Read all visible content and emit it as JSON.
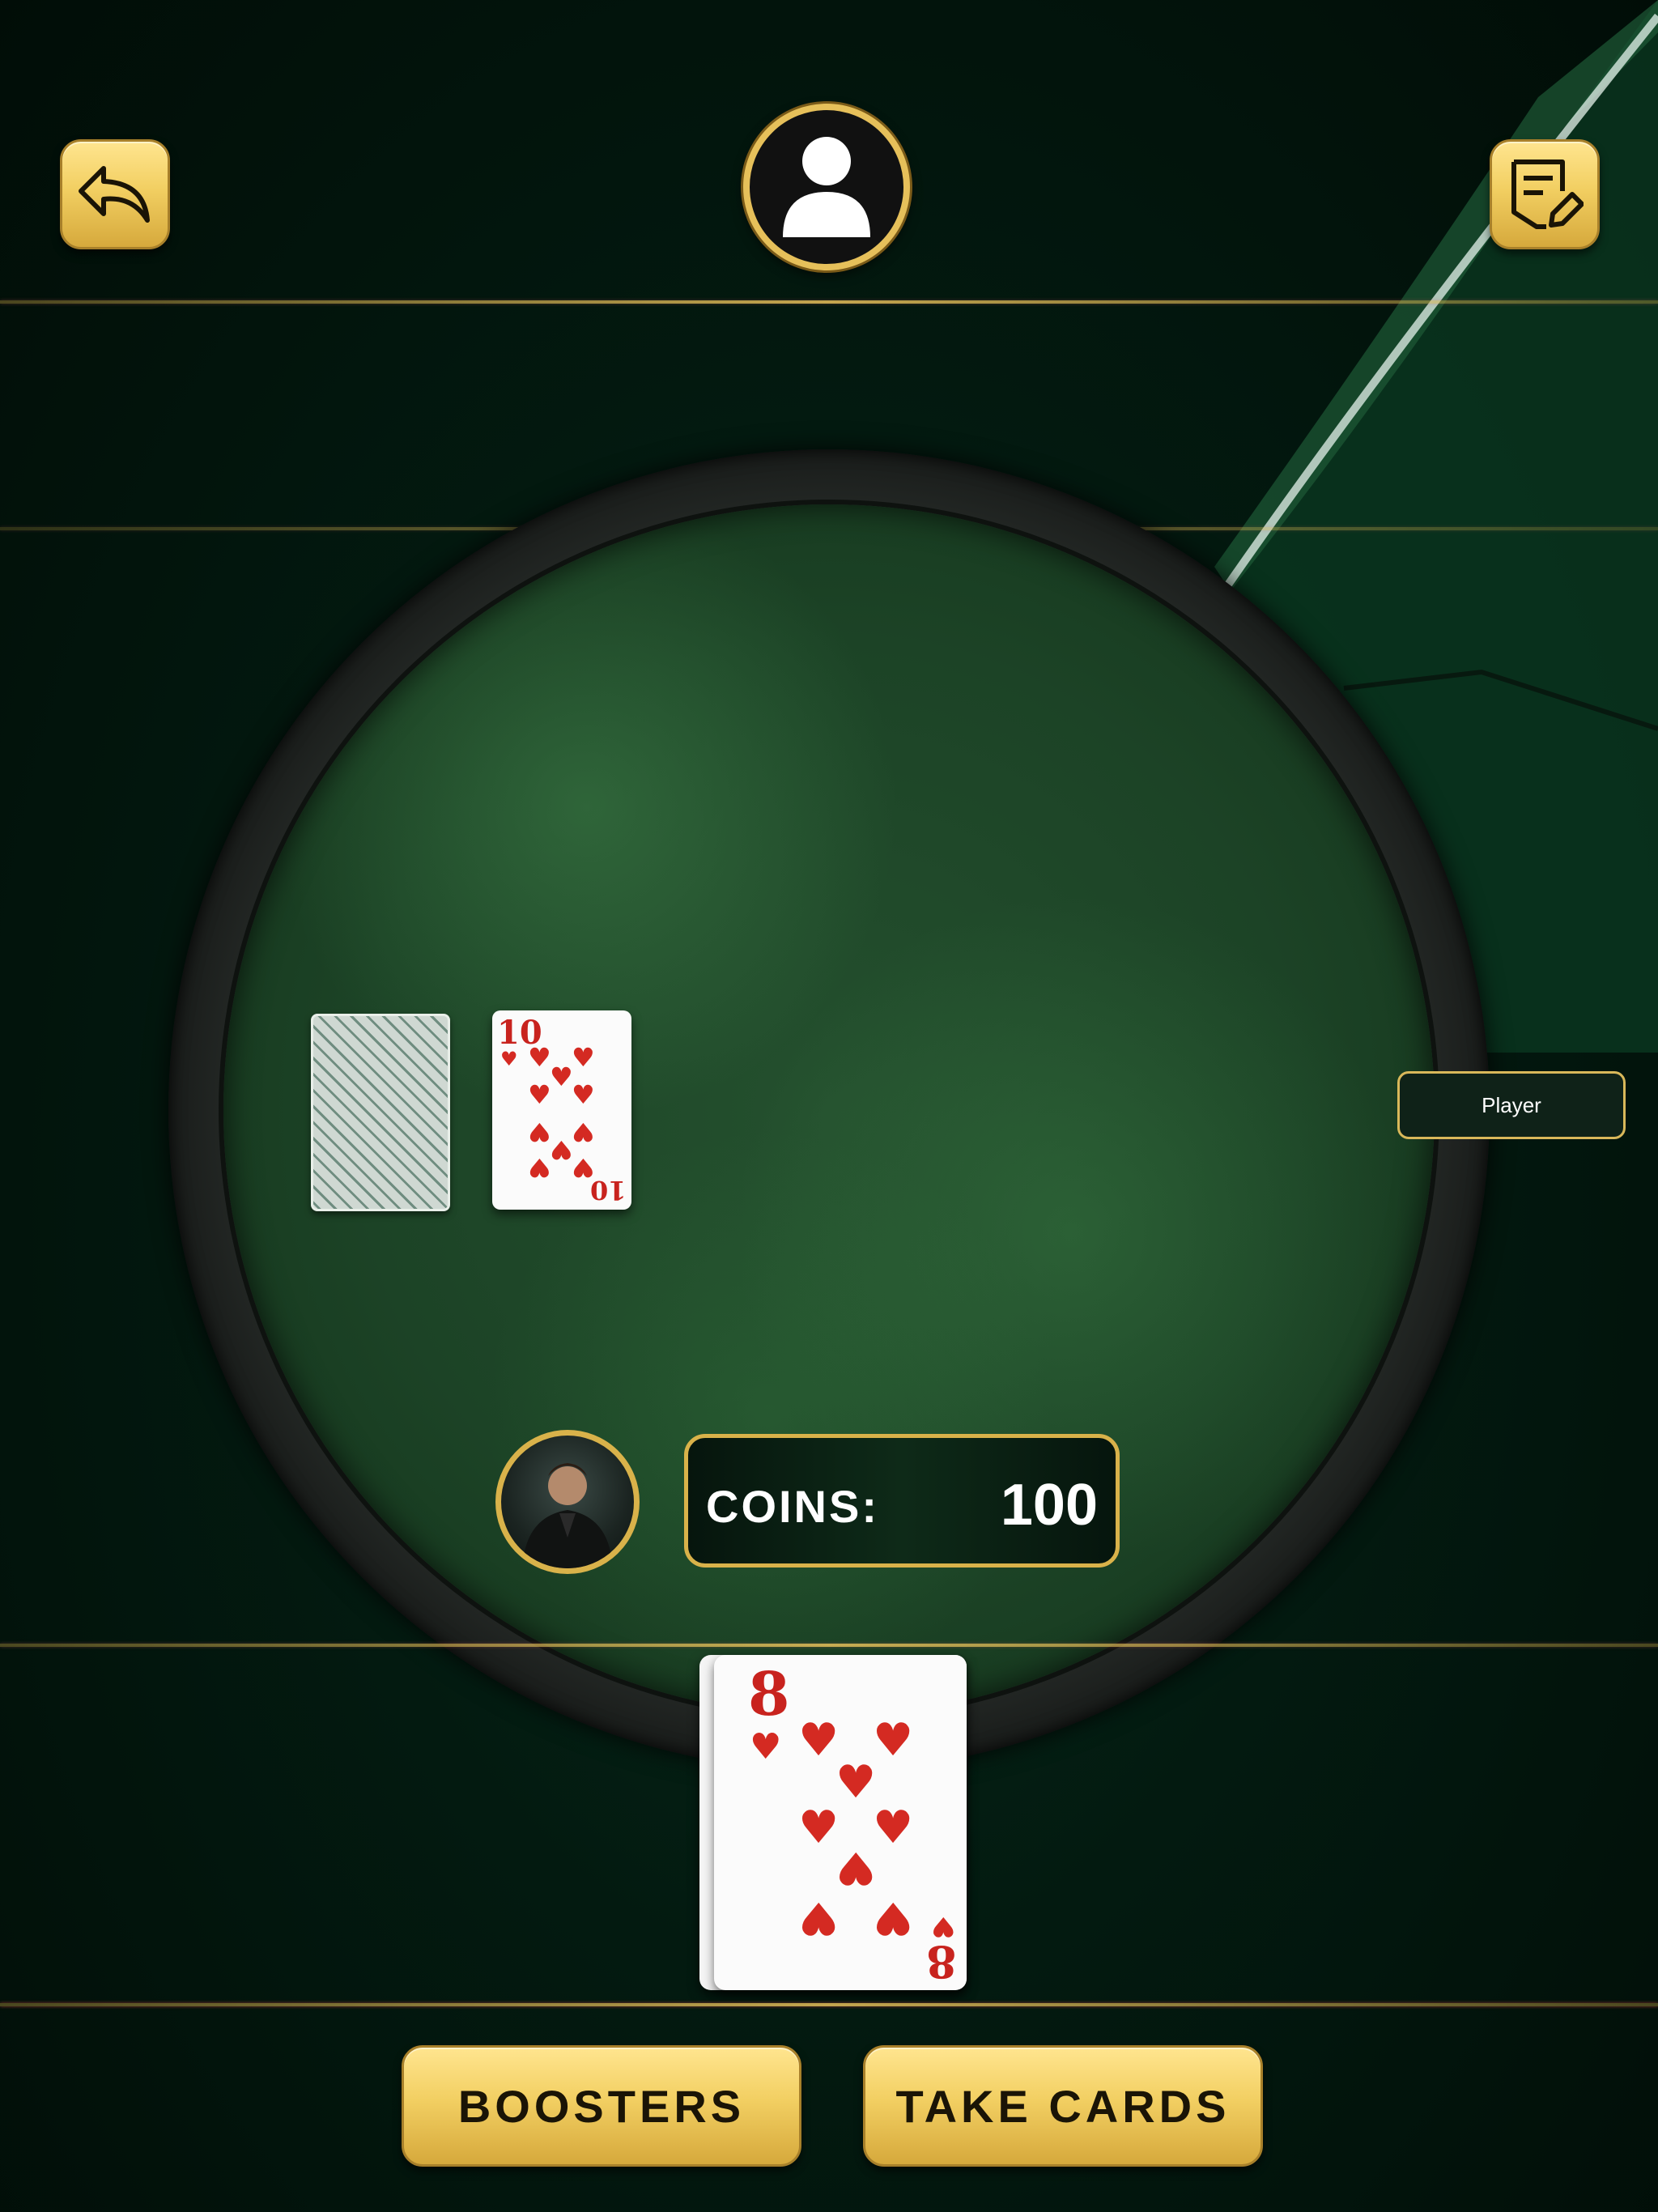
{
  "header": {
    "back_icon": "undo-arrow-icon",
    "profile_icon": "user-silhouette-icon",
    "notes_icon": "note-edit-icon"
  },
  "table": {
    "deck_card": "card-back",
    "played_card": {
      "rank": "10",
      "suit": "hearts"
    },
    "opponent_label": "Player"
  },
  "player": {
    "coins_label": "COINS:",
    "coins_value": "100"
  },
  "hand": {
    "top_card": {
      "rank": "8",
      "suit": "hearts"
    }
  },
  "actions": {
    "boosters_label": "BOOSTERS",
    "take_cards_label": "TAKE CARDS"
  },
  "colors": {
    "gold": "#f2cf62",
    "felt": "#1c4326",
    "heart_red": "#d42a22"
  }
}
